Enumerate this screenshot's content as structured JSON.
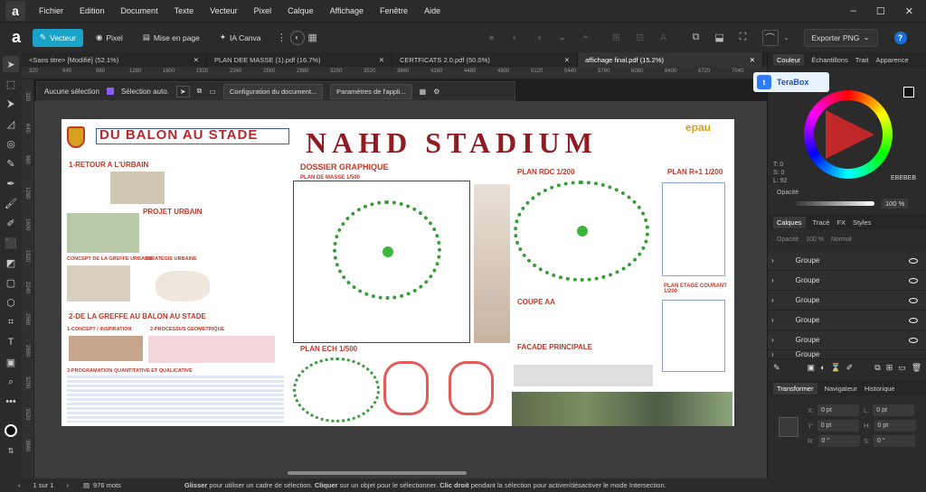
{
  "app": {
    "logo": "a"
  },
  "menu": [
    "Fichier",
    "Edition",
    "Document",
    "Texte",
    "Vecteur",
    "Pixel",
    "Calque",
    "Affichage",
    "Fenêtre",
    "Aide"
  ],
  "personas": [
    {
      "label": "Vecteur",
      "icon": "vector-persona-icon"
    },
    {
      "label": "Pixel",
      "icon": "pixel-persona-icon"
    },
    {
      "label": "Mise en page",
      "icon": "layout-persona-icon"
    },
    {
      "label": "IA Canva",
      "icon": "ai-persona-icon"
    }
  ],
  "export": {
    "label": "Exporter PNG"
  },
  "tabs": [
    {
      "label": "<Sans titre> [Modifié] (52.1%)",
      "active": false
    },
    {
      "label": "PLAN DEE MASSE (1).pdf (16.7%)",
      "active": false
    },
    {
      "label": "CERTFICATS 2.0.pdf (50.0%)",
      "active": false
    },
    {
      "label": "affichage final.pdf (15.2%)",
      "active": true
    }
  ],
  "ruler": [
    "320",
    "640",
    "960",
    "1280",
    "1600",
    "1920",
    "2240",
    "2560",
    "2880",
    "3200",
    "3520",
    "3840",
    "4160",
    "4480",
    "4800",
    "5120",
    "5440",
    "5760",
    "6080",
    "6400",
    "6720",
    "7040"
  ],
  "ruler_v": [
    "320",
    "640",
    "960",
    "1280",
    "1600",
    "1920",
    "2240",
    "2560",
    "2880",
    "3200",
    "3520",
    "3840"
  ],
  "context": {
    "selection": "Aucune sélection",
    "auto_select": "Sélection auto.",
    "doc_setup": "Configuration du document...",
    "app_prefs": "Paramètres de l'appli..."
  },
  "poster": {
    "title_left": "DU BALON AU STADE",
    "title_main": "NAHD STADIUM",
    "logo_text": "epau",
    "s1": "1-RETOUR A L'URBAIN",
    "s1a": "PROJET URBAIN",
    "s1b": "CONCEPT DE LA GREFFE URBAINE",
    "s1c": "STRATEGIE URBAINE",
    "s2": "2-DE LA GREFFE AU BALON AU STADE",
    "s2a": "1-CONCEPT / INSPIRATION",
    "s2b": "2-PROCESSUS GEOMETRIQUE",
    "s2c": "3-PROGRAMATION QUANTITATIVE ET QUALICATIVE",
    "dossier": "DOSSIER GRAPHIQUE",
    "masse": "PLAN DE MASSE 1/500",
    "ech": "PLAN ECH 1/500",
    "rdc": "PLAN RDC 1/200",
    "r1": "PLAN R+1 1/200",
    "etage": "PLAN ETAGE COURANT 1/200",
    "coupe": "COUPE AA",
    "facade": "FACADE PRINCIPALE"
  },
  "panel": {
    "tabs": [
      "Couleur",
      "Échantillons",
      "Trait",
      "Apparence"
    ],
    "terabox": "TeraBox",
    "hex": "EBEBEB",
    "hsl": [
      "T: 0",
      "S: 0",
      "L: 92"
    ],
    "opacity_label": "Opacité",
    "opacity_value": "100 %",
    "layer_tabs": [
      "Calques",
      "Tracé",
      "FX",
      "Styles"
    ],
    "layer_opacity": "Opacité",
    "layer_opacity_val": "100 %",
    "blend": "Normal",
    "layers": [
      "Groupe",
      "Groupe",
      "Groupe",
      "Groupe",
      "Groupe",
      "Groupe"
    ],
    "transform_tabs": [
      "Transformer",
      "Navigateur",
      "Historique"
    ],
    "fields": [
      {
        "k": "X:",
        "v": "0 pt"
      },
      {
        "k": "L:",
        "v": "0 pt"
      },
      {
        "k": "Y:",
        "v": "0 pt"
      },
      {
        "k": "H:",
        "v": "0 pt"
      },
      {
        "k": "R:",
        "v": "0 °"
      },
      {
        "k": "S:",
        "v": "0 °"
      }
    ]
  },
  "status": {
    "page": "1 sur 1",
    "words": "976 mots",
    "hint_b1": "Glisser",
    "hint_1": " pour utiliser un cadre de sélection. ",
    "hint_b2": "Cliquer",
    "hint_2": " sur un objet pour le sélectionner. ",
    "hint_b3": "Clic droit",
    "hint_3": " pendant la sélection pour activer/désactiver le mode Intersection."
  },
  "colors": {
    "accent": "#1aa3c9",
    "poster_red": "#c0392b",
    "blue_frame": "#3a5db8"
  }
}
